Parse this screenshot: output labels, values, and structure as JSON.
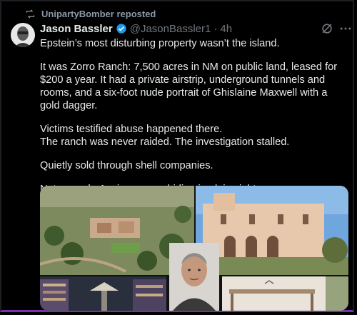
{
  "repost": {
    "icon": "repost-icon",
    "text": "UnipartyBomber reposted"
  },
  "author": {
    "name": "Jason Bassler",
    "handle": "@JasonBassler1",
    "separator": "·",
    "time": "4h",
    "verified_icon": "verified-badge-icon"
  },
  "actions": {
    "grok_icon": "grok-icon",
    "more_icon": "more-icon"
  },
  "tweet": {
    "paragraphs": [
      "Epstein’s most disturbing property wasn’t the island.",
      "It was Zorro Ranch: 7,500 acres in NM on public land, leased for $200 a year. It had a private airstrip, underground tunnels and rooms, and a six-foot nude portrait of Ghislaine Maxwell with a gold dagger.",
      "Victims testified abuse happened there.",
      "The ranch was never raided. The investigation stalled.",
      "Quietly sold through shell companies.",
      "Not a ranch. A crime scene hiding in plain sight."
    ]
  },
  "colors": {
    "background": "#000000",
    "text": "#e7e9ea",
    "muted": "#71767b",
    "verified": "#1d9bf0"
  }
}
